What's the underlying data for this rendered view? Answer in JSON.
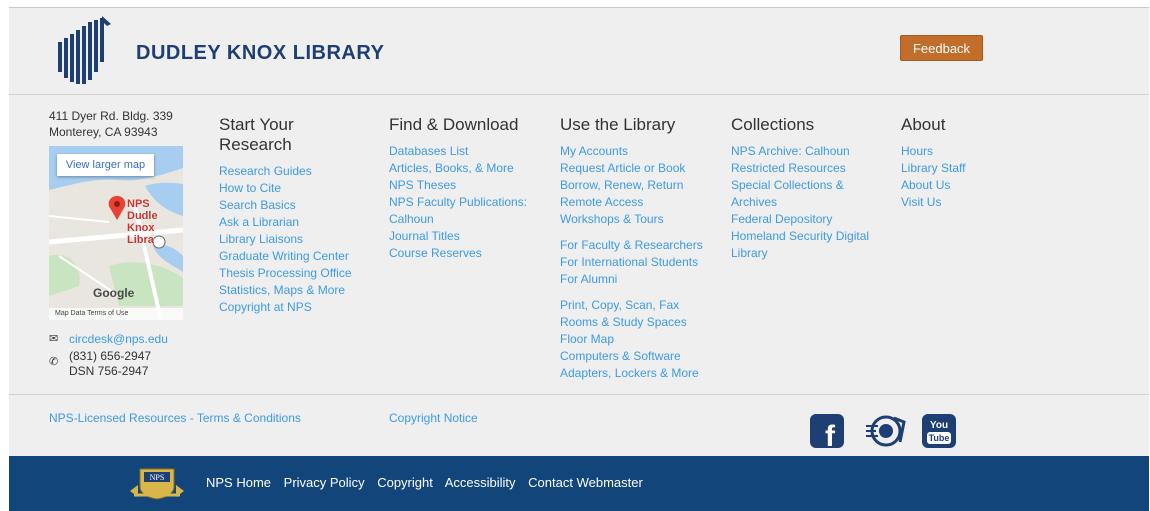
{
  "header": {
    "library_name": "DUDLEY KNOX LIBRARY",
    "feedback_label": "Feedback"
  },
  "contact": {
    "address_line1": "411 Dyer Rd. Bldg. 339",
    "address_line2": "Monterey, CA 93943",
    "email": "circdesk@nps.edu",
    "phone": "(831) 656-2947",
    "dsn": "DSN 756-2947"
  },
  "map": {
    "view_larger": "View larger map",
    "pin_label_1": "NPS Dudle",
    "pin_label_2": "Knox Libra",
    "google": "Google",
    "footer": "Map Data Terms of Use"
  },
  "columns": [
    {
      "title": "Start Your Research",
      "groups": [
        [
          "Research Guides",
          "How to Cite",
          "Search Basics",
          "Ask a Librarian",
          "Library Liaisons",
          "Graduate Writing Center",
          "Thesis Processing Office",
          "Statistics, Maps & More",
          "Copyright at NPS"
        ]
      ]
    },
    {
      "title": "Find & Download",
      "groups": [
        [
          "Databases List",
          "Articles, Books, & More",
          "NPS Theses",
          "NPS Faculty Publications:",
          "Calhoun",
          "Journal Titles",
          "Course Reserves"
        ]
      ]
    },
    {
      "title": "Use the Library",
      "groups": [
        [
          "My Accounts",
          "Request Article or Book",
          "Borrow, Renew, Return",
          "Remote Access",
          "Workshops & Tours"
        ],
        [
          "For Faculty & Researchers",
          "For International Students",
          "For Alumni"
        ],
        [
          "Print, Copy, Scan, Fax",
          "Rooms & Study Spaces",
          "Floor Map",
          "Computers & Software",
          "Adapters, Lockers & More"
        ]
      ]
    },
    {
      "title": "Collections",
      "groups": [
        [
          "NPS Archive: Calhoun",
          "Restricted Resources",
          "Special Collections &",
          "Archives",
          "Federal Depository",
          "Homeland Security Digital",
          "Library"
        ]
      ]
    },
    {
      "title": "About",
      "groups": [
        [
          "Hours",
          "Library Staff",
          "About Us",
          "Visit Us"
        ]
      ]
    }
  ],
  "footer_links": {
    "licensed": "NPS-Licensed Resources - Terms & Conditions",
    "copyright_notice": "Copyright Notice"
  },
  "social": {
    "icons": [
      "facebook-icon",
      "nps-logo-icon",
      "youtube-icon"
    ],
    "youtube_text": "You Tube",
    "facebook_text": "f"
  },
  "nps_bar": {
    "links": [
      "NPS Home",
      "Privacy Policy",
      "Copyright",
      "Accessibility",
      "Contact Webmaster"
    ],
    "seal_text": "NPS"
  },
  "colors": {
    "brand_navy": "#1d3f73",
    "link_blue": "#3d9ae8",
    "feedback_orange": "#c26d2a",
    "nps_bar": "#12467b",
    "background": "#efefef"
  }
}
